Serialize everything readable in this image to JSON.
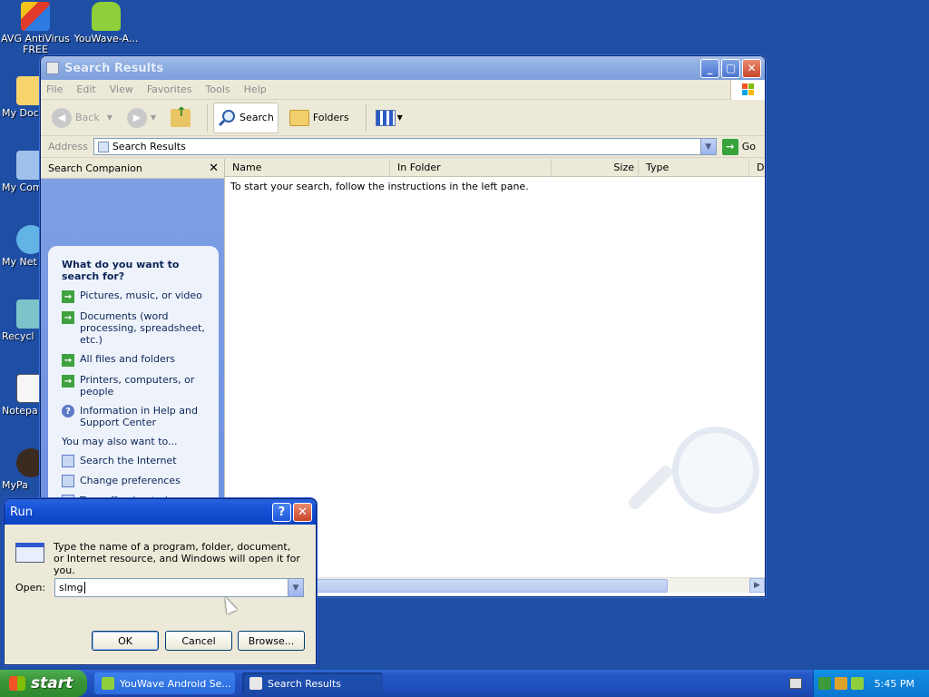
{
  "desktop": {
    "icons": [
      {
        "label": "AVG AntiVirus FREE",
        "icon": "avg-antivirus-icon"
      },
      {
        "label": "YouWave-A...",
        "icon": "android-icon"
      },
      {
        "label": "My Docu",
        "icon": "my-documents-icon"
      },
      {
        "label": "My Com",
        "icon": "my-computer-icon"
      },
      {
        "label": "My Net Plac",
        "icon": "network-places-icon"
      },
      {
        "label": "Recycl",
        "icon": "recycle-bin-icon"
      },
      {
        "label": "Notepa",
        "icon": "notepad-icon"
      },
      {
        "label": "MyPa",
        "icon": "mypaint-icon"
      }
    ]
  },
  "explorer": {
    "title": "Search Results",
    "menu": [
      "File",
      "Edit",
      "View",
      "Favorites",
      "Tools",
      "Help"
    ],
    "toolbar": {
      "back": "Back",
      "search": "Search",
      "folders": "Folders"
    },
    "address": {
      "label": "Address",
      "value": "Search Results",
      "go": "Go"
    },
    "pane": {
      "title": "Search Companion",
      "question": "What do you want to search for?",
      "options": [
        "Pictures, music, or video",
        "Documents (word processing, spreadsheet, etc.)",
        "All files and folders",
        "Printers, computers, or people",
        "Information in Help and Support Center"
      ],
      "also_label": "You may also want to...",
      "also_options": [
        "Search the Internet",
        "Change preferences",
        "Turn off animated character"
      ]
    },
    "columns": [
      "Name",
      "In Folder",
      "Size",
      "Type",
      "D"
    ],
    "empty_message": "To start your search, follow the instructions in the left pane."
  },
  "run_dialog": {
    "title": "Run",
    "help_btn": "?",
    "close_btn": "✕",
    "description": "Type the name of a program, folder, document, or Internet resource, and Windows will open it for you.",
    "open_label": "Open:",
    "open_value": "slmg",
    "ok": "OK",
    "cancel": "Cancel",
    "browse": "Browse..."
  },
  "taskbar": {
    "start": "start",
    "tasks": [
      "YouWave Android Se...",
      "Search Results"
    ],
    "clock": "5:45 PM"
  },
  "colors": {
    "desktop": "#1f4fa4",
    "accent": "#2457c6",
    "green": "#3ea23e"
  }
}
